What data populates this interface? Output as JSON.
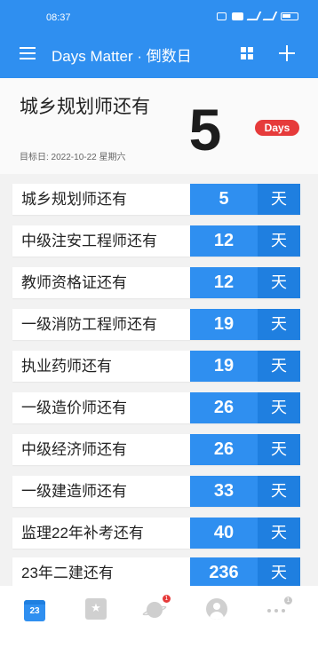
{
  "status_bar": {
    "time": "08:37",
    "icons": [
      "nfc-icon",
      "hd-icon",
      "signal-icon",
      "signal-icon",
      "battery-icon"
    ]
  },
  "appbar": {
    "title": "Days Matter · 倒数日",
    "menu_icon": "menu-icon",
    "grid_icon": "grid-view-icon",
    "add_icon": "plus-icon",
    "background": "#2f8ff0"
  },
  "hero": {
    "title": "城乡规划师还有",
    "target_date": "目标日: 2022-10-22 星期六",
    "days": "5",
    "badge": "Days",
    "badge_color": "#e63b3b"
  },
  "events": [
    {
      "name": "城乡规划师还有",
      "days": "5",
      "unit": "天"
    },
    {
      "name": "中级注安工程师还有",
      "days": "12",
      "unit": "天"
    },
    {
      "name": "教师资格证还有",
      "days": "12",
      "unit": "天"
    },
    {
      "name": "一级消防工程师还有",
      "days": "19",
      "unit": "天"
    },
    {
      "name": "执业药师还有",
      "days": "19",
      "unit": "天"
    },
    {
      "name": "一级造价师还有",
      "days": "26",
      "unit": "天"
    },
    {
      "name": "中级经济师还有",
      "days": "26",
      "unit": "天"
    },
    {
      "name": "一级建造师还有",
      "days": "33",
      "unit": "天"
    },
    {
      "name": "监理22年补考还有",
      "days": "40",
      "unit": "天"
    },
    {
      "name": "23年二建还有",
      "days": "236",
      "unit": "天"
    }
  ],
  "bottom_nav": {
    "calendar_label": "23",
    "items": [
      "calendar-icon",
      "card-star-icon",
      "planet-icon",
      "avatar-icon",
      "more-icon"
    ],
    "badges": {
      "planet": "1",
      "more": "1"
    },
    "active_color": "#2f8ff0"
  }
}
